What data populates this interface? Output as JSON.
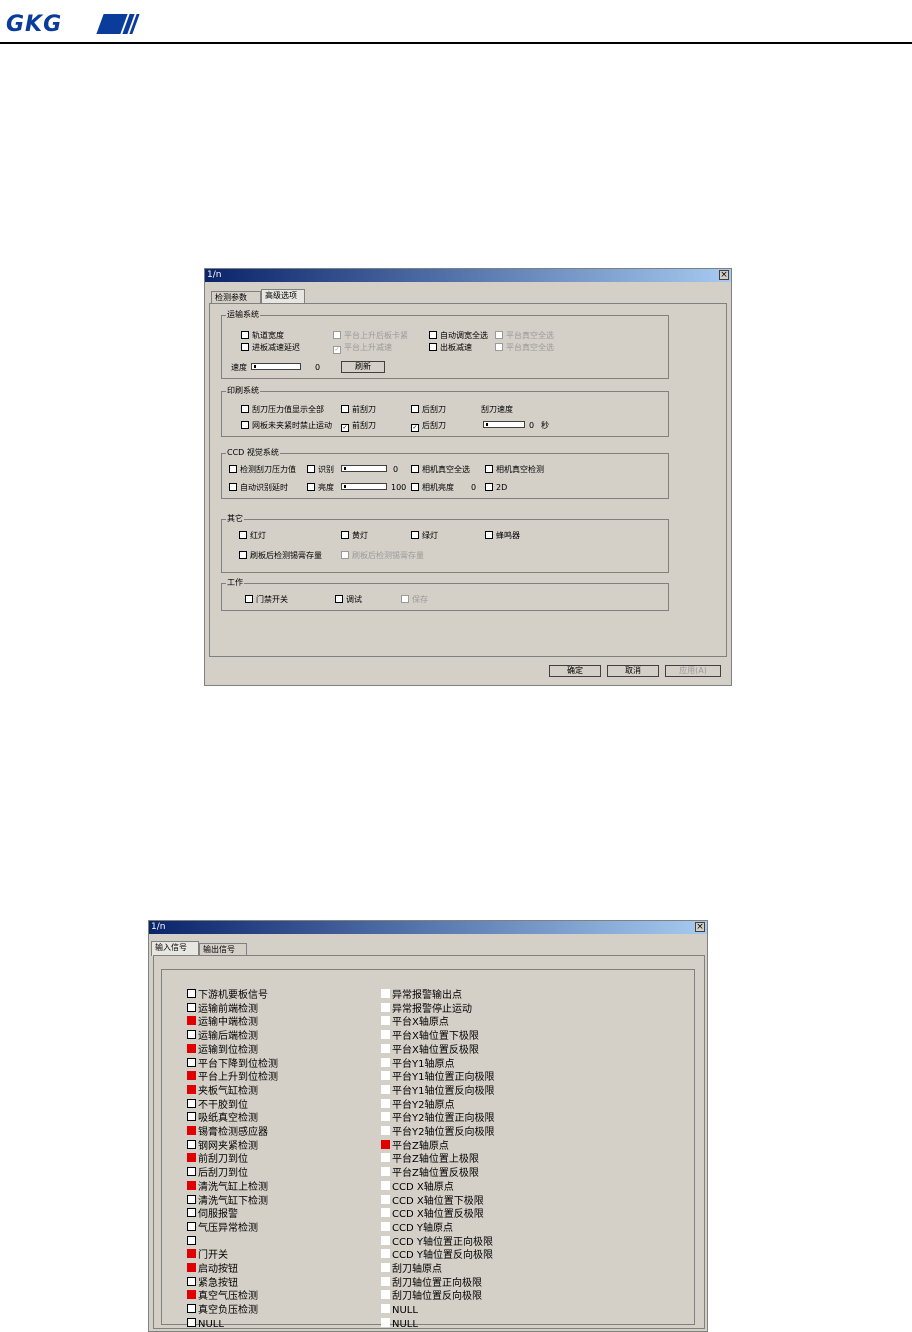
{
  "header": {
    "logo": "GKG"
  },
  "dialog1": {
    "title": "1/n",
    "close_glyph": "×",
    "tabs": [
      {
        "label": "检测参数"
      },
      {
        "label": "高级选项"
      }
    ],
    "groups": [
      {
        "label": "运输系统"
      },
      {
        "label": "印刷系统"
      },
      {
        "label": "CCD 视觉系统"
      },
      {
        "label": "其它"
      },
      {
        "label": "工作"
      }
    ],
    "g1": {
      "items": [
        {
          "label": "轨道宽度",
          "checked": false,
          "disabled": false
        },
        {
          "label": "平台上升后板卡紧",
          "checked": false,
          "disabled": true
        },
        {
          "label": "自动调宽全选",
          "checked": false,
          "disabled": false
        },
        {
          "label": "平台真空全选",
          "checked": false,
          "disabled": true
        },
        {
          "label": "进板减速延迟",
          "checked": false,
          "disabled": false
        },
        {
          "label": "平台上升减速",
          "checked": true,
          "disabled": true
        },
        {
          "label": "出板减速",
          "checked": false,
          "disabled": false
        },
        {
          "label": "平台真空全选",
          "checked": false,
          "disabled": true
        }
      ],
      "speed_label": "速度",
      "speed_value": "0",
      "button": "刷新"
    },
    "g2": {
      "items": [
        {
          "label": "刮刀压力值显示全部",
          "checked": false
        },
        {
          "label": "前刮刀",
          "checked": false
        },
        {
          "label": "后刮刀",
          "checked": false
        },
        {
          "label": "网板未夹紧时禁止运动",
          "checked": false
        },
        {
          "label": "前刮刀",
          "checked": true
        },
        {
          "label": "后刮刀",
          "checked": true
        }
      ],
      "speed_label": "刮刀速度",
      "speed_value": "0",
      "unit": "秒"
    },
    "g3": {
      "items": [
        {
          "label": "检测刮刀压力值",
          "checked": false
        },
        {
          "label": "识别",
          "checked": false
        },
        {
          "label": "相机真空全选",
          "checked": false
        },
        {
          "label": "相机真空检测",
          "checked": false
        },
        {
          "label": "自动识别延时",
          "checked": false
        },
        {
          "label": "亮度",
          "checked": false
        },
        {
          "label": "相机亮度",
          "checked": false
        },
        {
          "label": "2D",
          "checked": false
        }
      ],
      "val1": "0",
      "val2": "100",
      "val3": "0"
    },
    "g4": {
      "items": [
        {
          "label": "红灯",
          "checked": false,
          "disabled": false
        },
        {
          "label": "黄灯",
          "checked": false,
          "disabled": false
        },
        {
          "label": "绿灯",
          "checked": false,
          "disabled": false
        },
        {
          "label": "蜂鸣器",
          "checked": false,
          "disabled": false
        },
        {
          "label": "刷板后检测锡膏存量",
          "checked": false,
          "disabled": false
        },
        {
          "label": "刷板后检测锡膏存量",
          "checked": false,
          "disabled": true
        }
      ]
    },
    "g5": {
      "items": [
        {
          "label": "门禁开关",
          "checked": false,
          "disabled": false
        },
        {
          "label": "调试",
          "checked": false,
          "disabled": false
        },
        {
          "label": "保存",
          "checked": false,
          "disabled": true
        }
      ]
    },
    "buttons": {
      "ok": "确定",
      "cancel": "取消",
      "apply": "应用(A)"
    }
  },
  "dialog2": {
    "title": "1/n",
    "close_glyph": "×",
    "tabs": [
      {
        "label": "输入信号"
      },
      {
        "label": "输出信号"
      }
    ],
    "left_items": [
      {
        "label": "下游机要板信号",
        "state": "off"
      },
      {
        "label": "运输前端检测",
        "state": "off"
      },
      {
        "label": "运输中端检测",
        "state": "on"
      },
      {
        "label": "运输后端检测",
        "state": "off"
      },
      {
        "label": "运输到位检测",
        "state": "on"
      },
      {
        "label": "平台下降到位检测",
        "state": "off"
      },
      {
        "label": "平台上升到位检测",
        "state": "on"
      },
      {
        "label": "夹板气缸检测",
        "state": "on"
      },
      {
        "label": "不干胶到位",
        "state": "off"
      },
      {
        "label": "吸纸真空检测",
        "state": "off"
      },
      {
        "label": "锡膏检测感应器",
        "state": "on"
      },
      {
        "label": "钢网夹紧检测",
        "state": "off"
      },
      {
        "label": "前刮刀到位",
        "state": "on"
      },
      {
        "label": "后刮刀到位",
        "state": "off"
      },
      {
        "label": "清洗气缸上检测",
        "state": "on"
      },
      {
        "label": "清洗气缸下检测",
        "state": "off"
      },
      {
        "label": "伺服报警",
        "state": "off"
      },
      {
        "label": "气压异常检测",
        "state": "off"
      },
      {
        "label": "",
        "state": "off"
      },
      {
        "label": "门开关",
        "state": "on"
      },
      {
        "label": "启动按钮",
        "state": "on"
      },
      {
        "label": "紧急按钮",
        "state": "off"
      },
      {
        "label": "真空气压检测",
        "state": "on"
      },
      {
        "label": "真空负压检测",
        "state": "off"
      },
      {
        "label": "NULL",
        "state": "off"
      }
    ],
    "right_items": [
      {
        "label": "异常报警输出点",
        "state": "off"
      },
      {
        "label": "异常报警停止运动",
        "state": "off"
      },
      {
        "label": "平台X轴原点",
        "state": "off"
      },
      {
        "label": "平台X轴位置下极限",
        "state": "off"
      },
      {
        "label": "平台X轴位置反极限",
        "state": "off"
      },
      {
        "label": "平台Y1轴原点",
        "state": "off"
      },
      {
        "label": "平台Y1轴位置正向极限",
        "state": "off"
      },
      {
        "label": "平台Y1轴位置反向极限",
        "state": "off"
      },
      {
        "label": "平台Y2轴原点",
        "state": "off"
      },
      {
        "label": "平台Y2轴位置正向极限",
        "state": "off"
      },
      {
        "label": "平台Y2轴位置反向极限",
        "state": "off"
      },
      {
        "label": "平台Z轴原点",
        "state": "on"
      },
      {
        "label": "平台Z轴位置上极限",
        "state": "off"
      },
      {
        "label": "平台Z轴位置反极限",
        "state": "off"
      },
      {
        "label": "CCD X轴原点",
        "state": "off"
      },
      {
        "label": "CCD X轴位置下极限",
        "state": "off"
      },
      {
        "label": "CCD X轴位置反极限",
        "state": "off"
      },
      {
        "label": "CCD Y轴原点",
        "state": "off"
      },
      {
        "label": "CCD Y轴位置正向极限",
        "state": "off"
      },
      {
        "label": "CCD Y轴位置反向极限",
        "state": "off"
      },
      {
        "label": "刮刀轴原点",
        "state": "off"
      },
      {
        "label": "刮刀轴位置正向极限",
        "state": "off"
      },
      {
        "label": "刮刀轴位置反向极限",
        "state": "off"
      },
      {
        "label": "NULL",
        "state": "off"
      },
      {
        "label": "NULL",
        "state": "off"
      }
    ],
    "colors": {
      "on": "#e00000"
    }
  }
}
